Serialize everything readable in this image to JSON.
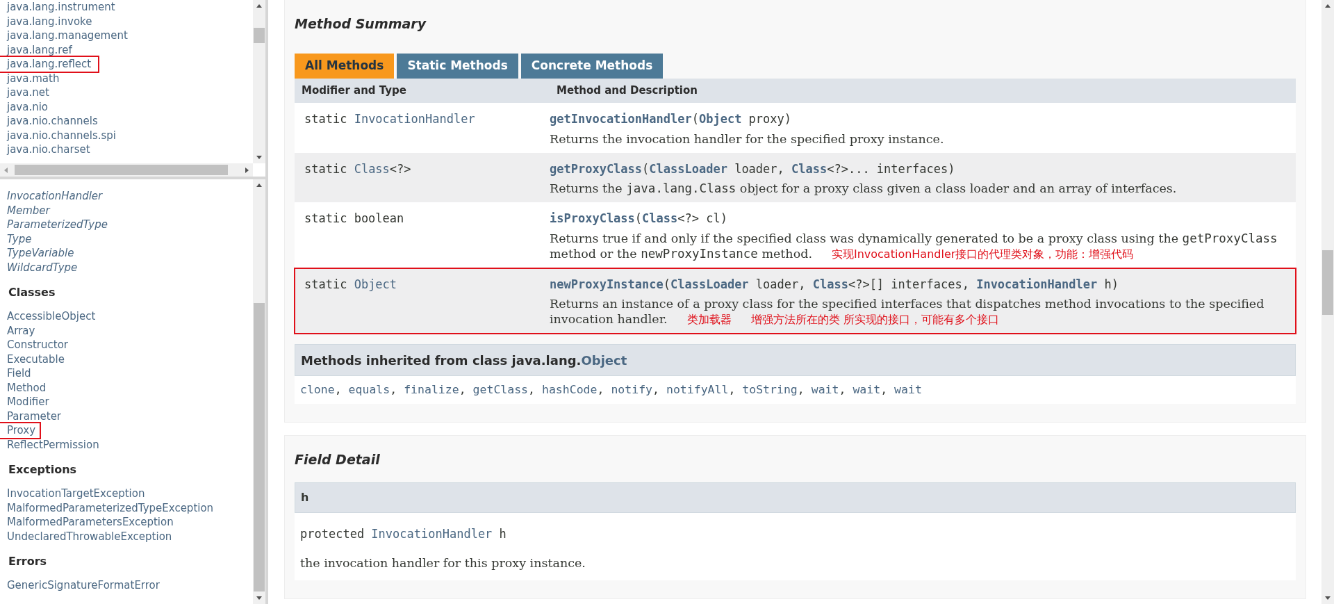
{
  "package_list": {
    "items": [
      {
        "label": "java.lang.instrument",
        "highlighted": false
      },
      {
        "label": "java.lang.invoke",
        "highlighted": false
      },
      {
        "label": "java.lang.management",
        "highlighted": false
      },
      {
        "label": "java.lang.ref",
        "highlighted": false
      },
      {
        "label": "java.lang.reflect",
        "highlighted": true
      },
      {
        "label": "java.math",
        "highlighted": false
      },
      {
        "label": "java.net",
        "highlighted": false
      },
      {
        "label": "java.nio",
        "highlighted": false
      },
      {
        "label": "java.nio.channels",
        "highlighted": false
      },
      {
        "label": "java.nio.channels.spi",
        "highlighted": false
      },
      {
        "label": "java.nio.charset",
        "highlighted": false
      }
    ]
  },
  "class_list": {
    "sections": [
      {
        "kind": "interfaces",
        "items": [
          {
            "label": "InvocationHandler",
            "highlighted": false
          },
          {
            "label": "Member",
            "highlighted": false
          },
          {
            "label": "ParameterizedType",
            "highlighted": false
          },
          {
            "label": "Type",
            "highlighted": false
          },
          {
            "label": "TypeVariable",
            "highlighted": false
          },
          {
            "label": "WildcardType",
            "highlighted": false
          }
        ]
      },
      {
        "kind": "classes",
        "heading": "Classes",
        "items": [
          {
            "label": "AccessibleObject",
            "highlighted": false
          },
          {
            "label": "Array",
            "highlighted": false
          },
          {
            "label": "Constructor",
            "highlighted": false
          },
          {
            "label": "Executable",
            "highlighted": false
          },
          {
            "label": "Field",
            "highlighted": false
          },
          {
            "label": "Method",
            "highlighted": false
          },
          {
            "label": "Modifier",
            "highlighted": false
          },
          {
            "label": "Parameter",
            "highlighted": false
          },
          {
            "label": "Proxy",
            "highlighted": true
          },
          {
            "label": "ReflectPermission",
            "highlighted": false
          }
        ]
      },
      {
        "kind": "classes",
        "heading": "Exceptions",
        "items": [
          {
            "label": "InvocationTargetException",
            "highlighted": false
          },
          {
            "label": "MalformedParameterizedTypeException",
            "highlighted": false
          },
          {
            "label": "MalformedParametersException",
            "highlighted": false
          },
          {
            "label": "UndeclaredThrowableException",
            "highlighted": false
          }
        ]
      },
      {
        "kind": "classes",
        "heading": "Errors",
        "items": [
          {
            "label": "GenericSignatureFormatError",
            "highlighted": false
          }
        ]
      }
    ]
  },
  "method_summary": {
    "title": "Method Summary",
    "tabs": [
      {
        "label": "All Methods",
        "selected": true
      },
      {
        "label": "Static Methods",
        "selected": false
      },
      {
        "label": "Concrete Methods",
        "selected": false
      }
    ],
    "columns": [
      "Modifier and Type",
      "Method and Description"
    ],
    "rows": [
      {
        "highlighted": false,
        "modifier": [
          {
            "kind": "plain",
            "text": "static "
          },
          {
            "kind": "link",
            "text": "InvocationHandler"
          }
        ],
        "signature": [
          {
            "kind": "name",
            "text": "getInvocationHandler"
          },
          {
            "kind": "plain",
            "text": "("
          },
          {
            "kind": "link",
            "text": "Object"
          },
          {
            "kind": "plain",
            "text": " proxy)"
          }
        ],
        "description": [
          {
            "kind": "text",
            "text": "Returns the invocation handler for the specified proxy instance."
          }
        ]
      },
      {
        "highlighted": false,
        "modifier": [
          {
            "kind": "plain",
            "text": "static "
          },
          {
            "kind": "link",
            "text": "Class"
          },
          {
            "kind": "plain",
            "text": "<?>"
          }
        ],
        "signature": [
          {
            "kind": "name",
            "text": "getProxyClass"
          },
          {
            "kind": "plain",
            "text": "("
          },
          {
            "kind": "link",
            "text": "ClassLoader"
          },
          {
            "kind": "plain",
            "text": " loader, "
          },
          {
            "kind": "link",
            "text": "Class"
          },
          {
            "kind": "plain",
            "text": "<?>... interfaces)"
          }
        ],
        "description": [
          {
            "kind": "text",
            "text": "Returns the "
          },
          {
            "kind": "code",
            "text": "java.lang.Class"
          },
          {
            "kind": "text",
            "text": " object for a proxy class given a class loader and an array of interfaces."
          }
        ]
      },
      {
        "highlighted": false,
        "modifier": [
          {
            "kind": "plain",
            "text": "static boolean"
          }
        ],
        "signature": [
          {
            "kind": "name",
            "text": "isProxyClass"
          },
          {
            "kind": "plain",
            "text": "("
          },
          {
            "kind": "link",
            "text": "Class"
          },
          {
            "kind": "plain",
            "text": "<?> cl)"
          }
        ],
        "description": [
          {
            "kind": "text",
            "text": "Returns true if and only if the specified class was dynamically generated to be a proxy class using the "
          },
          {
            "kind": "code",
            "text": "getProxyClass"
          },
          {
            "kind": "text",
            "text": " method or the "
          },
          {
            "kind": "code",
            "text": "newProxyInstance"
          },
          {
            "kind": "text",
            "text": " method."
          }
        ],
        "notes": [
          "实现InvocationHandler接口的代理类对象，功能：增强代码"
        ]
      },
      {
        "highlighted": true,
        "modifier": [
          {
            "kind": "plain",
            "text": "static "
          },
          {
            "kind": "link",
            "text": "Object"
          }
        ],
        "signature": [
          {
            "kind": "name",
            "text": "newProxyInstance"
          },
          {
            "kind": "plain",
            "text": "("
          },
          {
            "kind": "link",
            "text": "ClassLoader"
          },
          {
            "kind": "plain",
            "text": " loader, "
          },
          {
            "kind": "link",
            "text": "Class"
          },
          {
            "kind": "plain",
            "text": "<?>[] interfaces, "
          },
          {
            "kind": "link",
            "text": "InvocationHandler"
          },
          {
            "kind": "plain",
            "text": " h)"
          }
        ],
        "description": [
          {
            "kind": "text",
            "text": "Returns an instance of a proxy class for the specified interfaces that dispatches method invocations to the specified invocation handler."
          }
        ],
        "notes": [
          "类加载器",
          "增强方法所在的类 所实现的接口，可能有多个接口"
        ]
      }
    ],
    "inherited": {
      "heading": "Methods inherited from class java.lang.",
      "heading_link": "Object",
      "separator": ",",
      "methods": [
        "clone",
        "equals",
        "finalize",
        "getClass",
        "hashCode",
        "notify",
        "notifyAll",
        "toString",
        "wait",
        "wait",
        "wait"
      ]
    }
  },
  "field_detail": {
    "title": "Field Detail",
    "field_name": "h",
    "signature": [
      {
        "kind": "plain",
        "text": "protected "
      },
      {
        "kind": "link",
        "text": "InvocationHandler"
      },
      {
        "kind": "plain",
        "text": " h"
      }
    ],
    "description": "the invocation handler for this proxy instance."
  }
}
